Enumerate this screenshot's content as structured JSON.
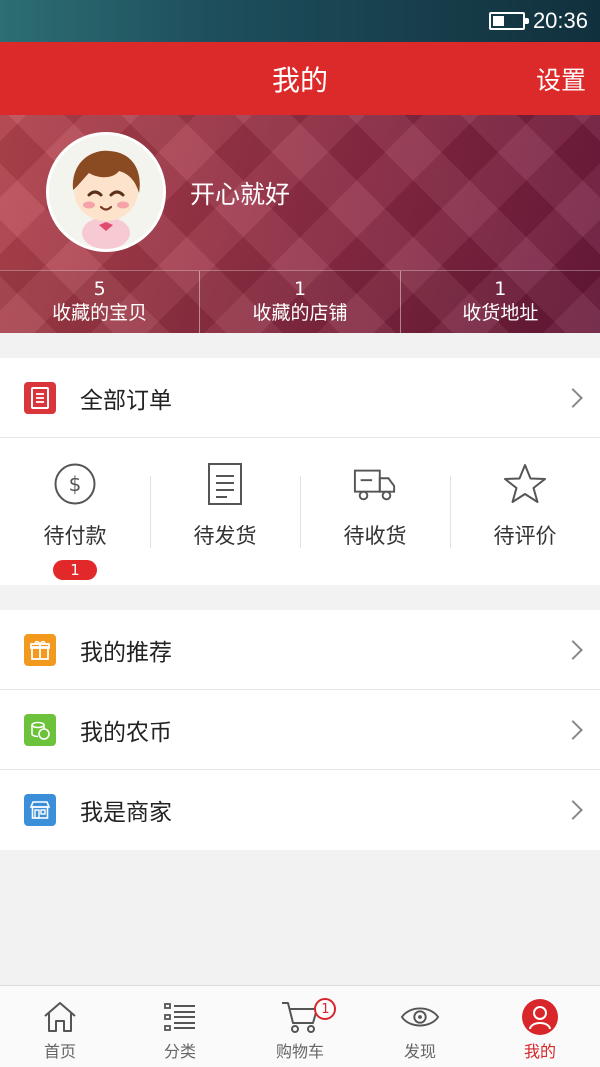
{
  "status_bar": {
    "time": "20:36",
    "battery_level": 0.4
  },
  "header": {
    "title": "我的",
    "settings_label": "设置"
  },
  "profile": {
    "nickname": "开心就好",
    "stats": [
      {
        "count": "5",
        "label": "收藏的宝贝"
      },
      {
        "count": "1",
        "label": "收藏的店铺"
      },
      {
        "count": "1",
        "label": "收货地址"
      }
    ]
  },
  "orders": {
    "all_orders_label": "全部订单",
    "statuses": [
      {
        "label": "待付款",
        "icon": "dollar-circle-icon",
        "badge": "1"
      },
      {
        "label": "待发货",
        "icon": "document-icon"
      },
      {
        "label": "待收货",
        "icon": "truck-icon"
      },
      {
        "label": "待评价",
        "icon": "star-icon"
      }
    ]
  },
  "menu": [
    {
      "label": "我的推荐",
      "icon": "gift-icon",
      "color": "#f39a1e"
    },
    {
      "label": "我的农币",
      "icon": "coins-icon",
      "color": "#6cc23a"
    },
    {
      "label": "我是商家",
      "icon": "shop-icon",
      "color": "#3a8fd8"
    }
  ],
  "bottom_nav": {
    "items": [
      {
        "label": "首页",
        "icon": "home-icon"
      },
      {
        "label": "分类",
        "icon": "list-icon"
      },
      {
        "label": "购物车",
        "icon": "cart-icon",
        "badge": "1"
      },
      {
        "label": "发现",
        "icon": "eye-icon"
      },
      {
        "label": "我的",
        "icon": "user-icon",
        "active": true
      }
    ]
  },
  "colors": {
    "brand_red": "#dc2a2a",
    "active_tab": "#d8262a",
    "badge_red": "#e3282a"
  }
}
